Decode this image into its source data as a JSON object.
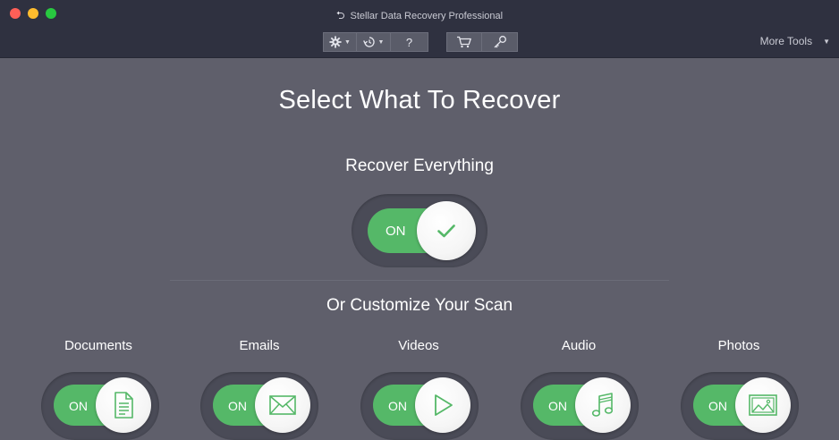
{
  "window": {
    "title": "Stellar Data Recovery Professional",
    "more_tools": "More Tools"
  },
  "toolbar": {
    "help_label": "?",
    "icons": [
      "gear-icon",
      "history-icon",
      "help-icon",
      "cart-icon",
      "key-icon"
    ]
  },
  "main": {
    "title": "Select What To Recover",
    "recover_everything": {
      "label": "Recover Everything",
      "state": "ON"
    },
    "customize_title": "Or Customize Your Scan",
    "categories": [
      {
        "label": "Documents",
        "state": "ON",
        "icon": "document-icon"
      },
      {
        "label": "Emails",
        "state": "ON",
        "icon": "email-icon"
      },
      {
        "label": "Videos",
        "state": "ON",
        "icon": "play-icon"
      },
      {
        "label": "Audio",
        "state": "ON",
        "icon": "music-icon"
      },
      {
        "label": "Photos",
        "state": "ON",
        "icon": "photo-icon"
      }
    ]
  },
  "colors": {
    "background": "#5f5f6b",
    "titlebar": "#2f3140",
    "toggle_on": "#55b868",
    "toggle_well": "#4a4b57",
    "accent_icon": "#55b868"
  }
}
